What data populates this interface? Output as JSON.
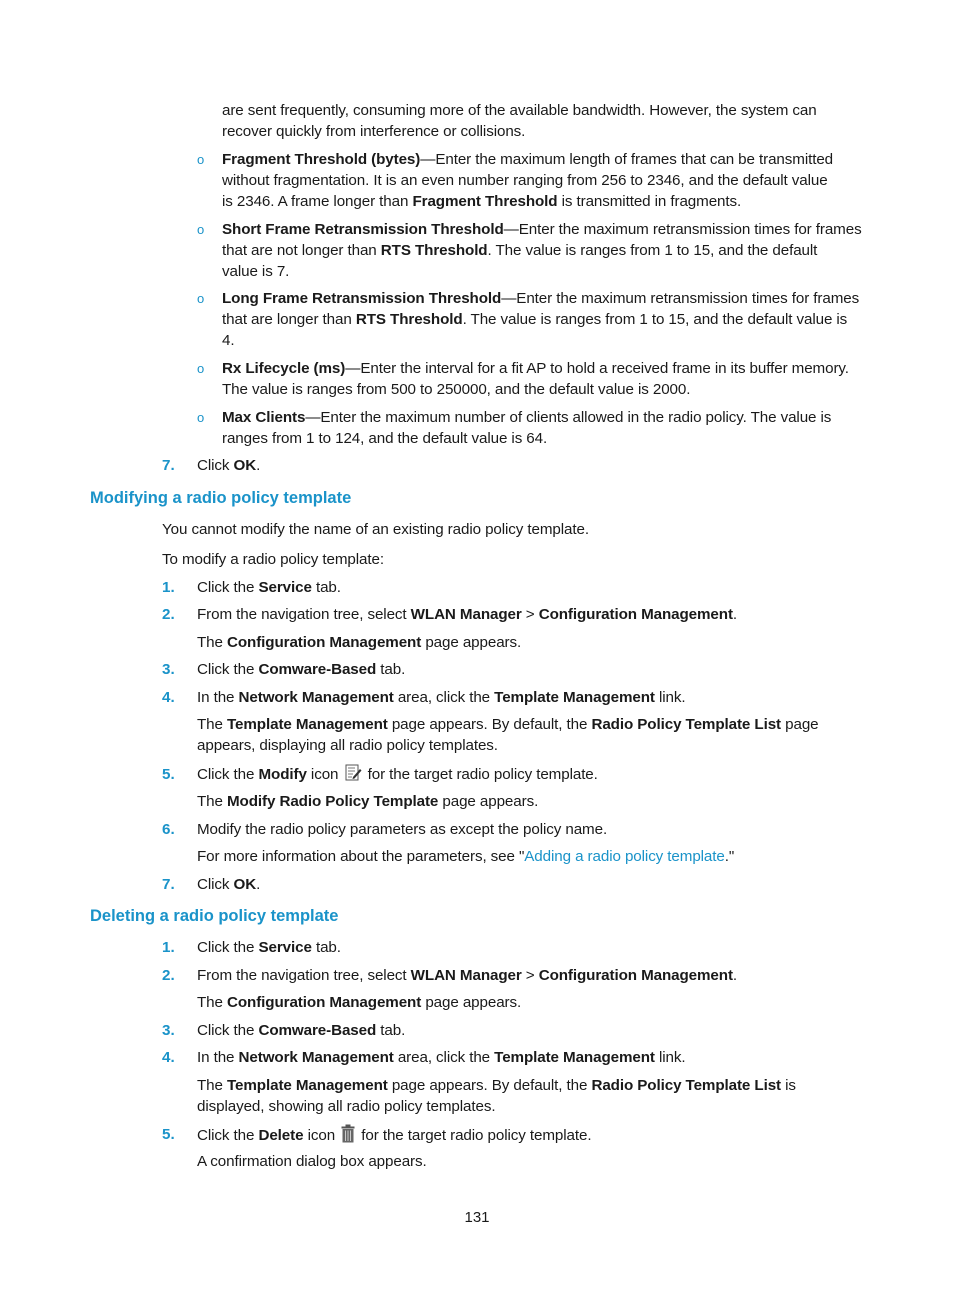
{
  "page_number": "131",
  "intro_continuation": [
    "are sent frequently, consuming more of the available bandwidth. However, the system can",
    "recover quickly from interference or collisions."
  ],
  "parameters": [
    {
      "term": "Fragment Threshold (bytes)",
      "lines": [
        {
          "segments": [
            {
              "b": "Fragment Threshold (bytes)"
            },
            {
              "t": "—Enter the maximum length of frames that can be transmitted"
            }
          ]
        },
        {
          "segments": [
            {
              "t": "without fragmentation. It is an even number ranging from 256 to 2346, and the default value"
            }
          ]
        },
        {
          "segments": [
            {
              "t": "is 2346. A frame longer than "
            },
            {
              "b": "Fragment Threshold"
            },
            {
              "t": " is transmitted in fragments."
            }
          ]
        }
      ]
    },
    {
      "term": "Short Frame Retransmission Threshold",
      "lines": [
        {
          "segments": [
            {
              "b": "Short Frame Retransmission Threshold"
            },
            {
              "t": "—Enter the maximum retransmission times for frames"
            }
          ]
        },
        {
          "segments": [
            {
              "t": "that are not longer than "
            },
            {
              "b": "RTS Threshold"
            },
            {
              "t": ". The value is ranges from 1 to 15, and the default"
            }
          ]
        },
        {
          "segments": [
            {
              "t": "value is 7."
            }
          ]
        }
      ]
    },
    {
      "term": "Long Frame Retransmission Threshold",
      "lines": [
        {
          "segments": [
            {
              "b": "Long Frame Retransmission Threshold"
            },
            {
              "t": "—Enter the maximum retransmission times for frames"
            }
          ]
        },
        {
          "segments": [
            {
              "t": "that are longer than "
            },
            {
              "b": "RTS Threshold"
            },
            {
              "t": ". The value is ranges from 1 to 15, and the default value is"
            }
          ]
        },
        {
          "segments": [
            {
              "t": "4."
            }
          ]
        }
      ]
    },
    {
      "term": "Rx Lifecycle (ms)",
      "lines": [
        {
          "segments": [
            {
              "b": "Rx Lifecycle (ms)"
            },
            {
              "t": "—Enter the interval for a fit AP to hold a received frame in its buffer memory."
            }
          ]
        },
        {
          "segments": [
            {
              "t": "The value is ranges from 500 to 250000, and the default value is 2000."
            }
          ]
        }
      ]
    },
    {
      "term": "Max Clients",
      "lines": [
        {
          "segments": [
            {
              "b": "Max Clients"
            },
            {
              "t": "—Enter the maximum number of clients allowed in the radio policy. The value is"
            }
          ]
        },
        {
          "segments": [
            {
              "t": "ranges from 1 to 124, and the default value is 64."
            }
          ]
        }
      ]
    }
  ],
  "add_step7": {
    "num": "7.",
    "segments": [
      {
        "t": "Click "
      },
      {
        "b": "OK"
      },
      {
        "t": "."
      }
    ]
  },
  "modify_section": {
    "heading": "Modifying a radio policy template",
    "para1": "You cannot modify the name of an existing radio policy template.",
    "para2": "To modify a radio policy template:",
    "steps": [
      {
        "num": "1.",
        "lines": [
          {
            "segments": [
              {
                "t": "Click the "
              },
              {
                "b": "Service"
              },
              {
                "t": " tab."
              }
            ]
          }
        ]
      },
      {
        "num": "2.",
        "lines": [
          {
            "segments": [
              {
                "t": "From the navigation tree, select "
              },
              {
                "b": "WLAN Manager"
              },
              {
                "t": " > "
              },
              {
                "b": "Configuration Management"
              },
              {
                "t": "."
              }
            ]
          }
        ],
        "note": [
          {
            "segments": [
              {
                "t": "The "
              },
              {
                "b": "Configuration Management"
              },
              {
                "t": " page appears."
              }
            ]
          }
        ]
      },
      {
        "num": "3.",
        "lines": [
          {
            "segments": [
              {
                "t": "Click the "
              },
              {
                "b": "Comware-Based"
              },
              {
                "t": " tab."
              }
            ]
          }
        ]
      },
      {
        "num": "4.",
        "lines": [
          {
            "segments": [
              {
                "t": "In the "
              },
              {
                "b": "Network Management"
              },
              {
                "t": " area, click the "
              },
              {
                "b": "Template Management"
              },
              {
                "t": " link."
              }
            ]
          }
        ],
        "note": [
          {
            "segments": [
              {
                "t": "The "
              },
              {
                "b": "Template Management"
              },
              {
                "t": " page appears. By default, the "
              },
              {
                "b": "Radio Policy Template List"
              },
              {
                "t": " page"
              }
            ]
          },
          {
            "segments": [
              {
                "t": "appears, displaying all radio policy templates."
              }
            ]
          }
        ]
      },
      {
        "num": "5.",
        "lines": [
          {
            "segments": [
              {
                "t": "Click the "
              },
              {
                "b": "Modify"
              },
              {
                "t": " icon "
              },
              {
                "icon": "modify"
              },
              {
                "t": " for the target radio policy template."
              }
            ]
          }
        ],
        "note": [
          {
            "segments": [
              {
                "t": "The "
              },
              {
                "b": "Modify Radio Policy Template"
              },
              {
                "t": " page appears."
              }
            ]
          }
        ]
      },
      {
        "num": "6.",
        "lines": [
          {
            "segments": [
              {
                "t": "Modify the radio policy parameters as except the policy name."
              }
            ]
          }
        ],
        "note": [
          {
            "segments": [
              {
                "t": "For more information about the parameters, see \""
              },
              {
                "link": "Adding a radio policy template"
              },
              {
                "t": ".\""
              }
            ]
          }
        ]
      },
      {
        "num": "7.",
        "lines": [
          {
            "segments": [
              {
                "t": "Click "
              },
              {
                "b": "OK"
              },
              {
                "t": "."
              }
            ]
          }
        ]
      }
    ]
  },
  "delete_section": {
    "heading": "Deleting a radio policy template",
    "steps": [
      {
        "num": "1.",
        "lines": [
          {
            "segments": [
              {
                "t": "Click the "
              },
              {
                "b": "Service"
              },
              {
                "t": " tab."
              }
            ]
          }
        ]
      },
      {
        "num": "2.",
        "lines": [
          {
            "segments": [
              {
                "t": "From the navigation tree, select "
              },
              {
                "b": "WLAN Manager"
              },
              {
                "t": " > "
              },
              {
                "b": "Configuration Management"
              },
              {
                "t": "."
              }
            ]
          }
        ],
        "note": [
          {
            "segments": [
              {
                "t": "The "
              },
              {
                "b": "Configuration Management"
              },
              {
                "t": " page appears."
              }
            ]
          }
        ]
      },
      {
        "num": "3.",
        "lines": [
          {
            "segments": [
              {
                "t": "Click the "
              },
              {
                "b": "Comware-Based"
              },
              {
                "t": " tab."
              }
            ]
          }
        ]
      },
      {
        "num": "4.",
        "lines": [
          {
            "segments": [
              {
                "t": "In the "
              },
              {
                "b": "Network Management"
              },
              {
                "t": " area, click the "
              },
              {
                "b": "Template Management"
              },
              {
                "t": " link."
              }
            ]
          }
        ],
        "note": [
          {
            "segments": [
              {
                "t": "The "
              },
              {
                "b": "Template Management"
              },
              {
                "t": " page appears. By default, the "
              },
              {
                "b": "Radio Policy Template List"
              },
              {
                "t": " is"
              }
            ]
          },
          {
            "segments": [
              {
                "t": "displayed, showing all radio policy templates."
              }
            ]
          }
        ]
      },
      {
        "num": "5.",
        "lines": [
          {
            "segments": [
              {
                "t": "Click the "
              },
              {
                "b": "Delete"
              },
              {
                "t": " icon "
              },
              {
                "icon": "delete"
              },
              {
                "t": " for the target radio policy template."
              }
            ]
          }
        ],
        "note": [
          {
            "segments": [
              {
                "t": "A confirmation dialog box appears."
              }
            ]
          }
        ]
      }
    ]
  },
  "colors": {
    "accent": "#1a93c9",
    "text": "#1a1a1a"
  }
}
